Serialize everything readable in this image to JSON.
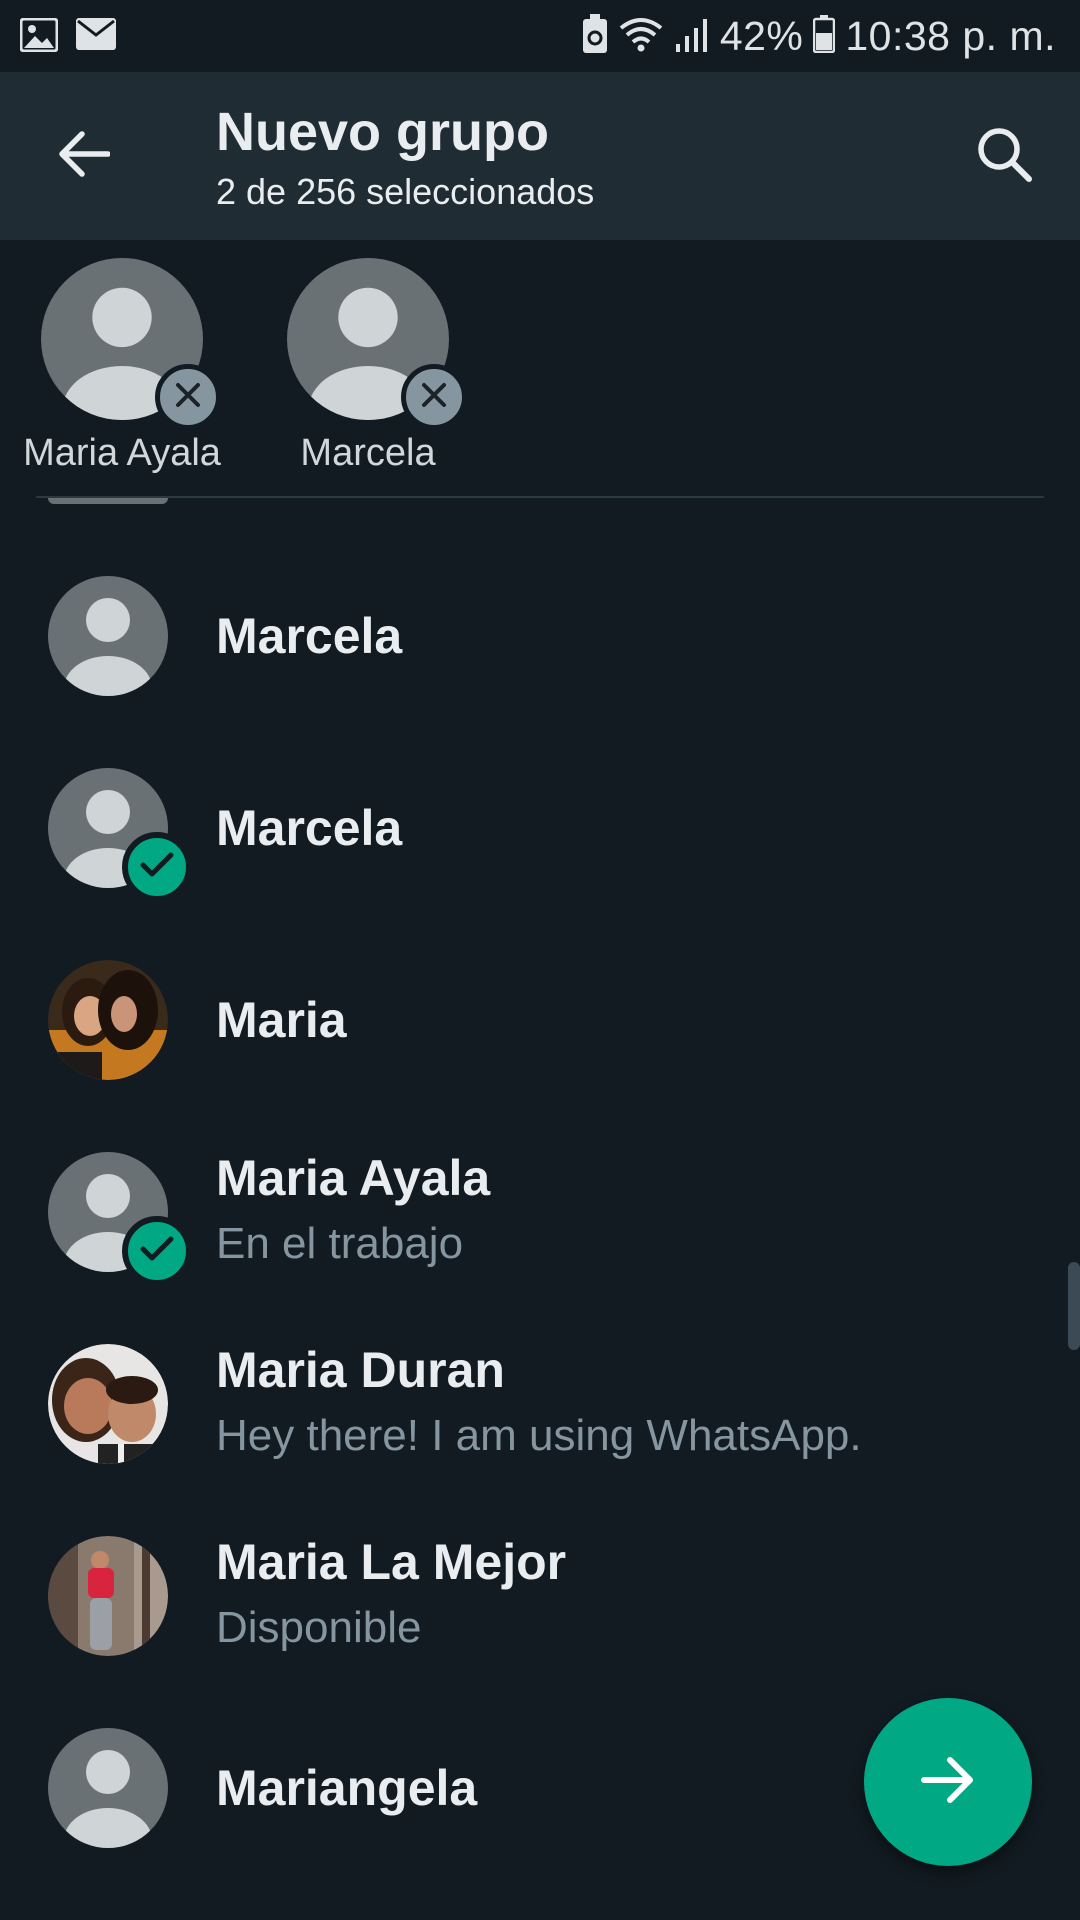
{
  "status_bar": {
    "battery": "42%",
    "time": "10:38 p. m."
  },
  "header": {
    "title": "Nuevo grupo",
    "subtitle": "2 de 256 seleccionados"
  },
  "selected": [
    {
      "name": "Maria Ayala"
    },
    {
      "name": "Marcela"
    }
  ],
  "contacts": [
    {
      "name": "Marcela",
      "status": "",
      "selected": false,
      "avatar": "default"
    },
    {
      "name": "Marcela",
      "status": "",
      "selected": true,
      "avatar": "default"
    },
    {
      "name": "Maria",
      "status": "",
      "selected": false,
      "avatar": "photo-two-women"
    },
    {
      "name": "Maria Ayala",
      "status": "En el trabajo",
      "selected": true,
      "avatar": "default"
    },
    {
      "name": "Maria Duran",
      "status": "Hey there! I am using WhatsApp.",
      "selected": false,
      "avatar": "photo-mother-child"
    },
    {
      "name": "Maria La Mejor",
      "status": "Disponible",
      "selected": false,
      "avatar": "photo-woman-red"
    },
    {
      "name": "Mariangela",
      "status": "",
      "selected": false,
      "avatar": "default"
    }
  ],
  "colors": {
    "background": "#121b22",
    "app_bar": "#202c33",
    "accent": "#00a884",
    "avatar_bg": "#6a7175",
    "secondary_text": "#8696a0"
  },
  "icons": {
    "back": "arrow-left-icon",
    "search": "search-icon",
    "remove": "close-icon",
    "check": "check-icon",
    "next": "arrow-right-icon"
  }
}
